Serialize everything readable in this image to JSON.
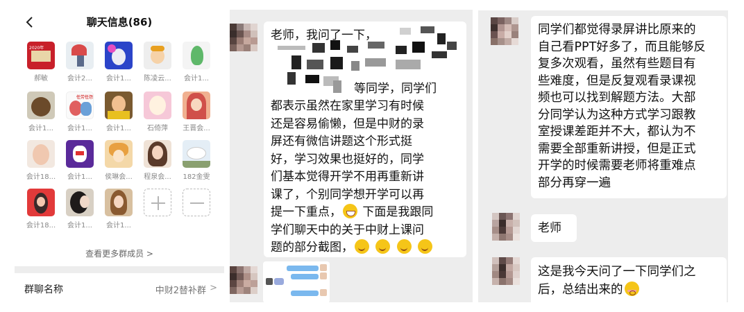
{
  "group_info": {
    "title": "聊天信息(86)",
    "members": [
      {
        "name": "郝敏",
        "avatar_text": "2020年"
      },
      {
        "name": "会计2...",
        "avatar_text": ""
      },
      {
        "name": "会计1...",
        "avatar_text": ""
      },
      {
        "name": "陈凌云...",
        "avatar_text": ""
      },
      {
        "name": "会计1...",
        "avatar_text": ""
      },
      {
        "name": "会计1...",
        "avatar_text": ""
      },
      {
        "name": "会计1...",
        "avatar_text": "任劳任怨"
      },
      {
        "name": "会计1...",
        "avatar_text": ""
      },
      {
        "name": "石倚萍",
        "avatar_text": ""
      },
      {
        "name": "王晋会...",
        "avatar_text": ""
      },
      {
        "name": "会计18...",
        "avatar_text": ""
      },
      {
        "name": "会计1...",
        "avatar_text": ""
      },
      {
        "name": "侯琳会...",
        "avatar_text": ""
      },
      {
        "name": "程泉会...",
        "avatar_text": ""
      },
      {
        "name": "182金雯",
        "avatar_text": ""
      },
      {
        "name": "会计18...",
        "avatar_text": ""
      },
      {
        "name": "会计1...",
        "avatar_text": ""
      },
      {
        "name": "会计1...",
        "avatar_text": ""
      }
    ],
    "more_members": "查看更多群成员 >",
    "group_name_label": "群聊名称",
    "group_name_value": "中财2替补群",
    "chevron": ">"
  },
  "chat_left": {
    "bubble_lines": [
      "老师，我问了一下，",
      "",
      "",
      "等同学，同学们",
      "都表示虽然在家里学习有时候",
      "还是容易偷懒，但是中财的录",
      "屏还有微信讲题这个形式挺",
      "好，学习效果也挺好的，同学",
      "们基本觉得开学不用再重新讲",
      "课了，个别同学想开学可以再",
      "提一下重点，",
      "学们聊天中的关于中财上课问",
      "题的部分截图，"
    ],
    "line_11_tail": "下面是我跟同"
  },
  "chat_right": {
    "summary_lines": [
      "同学们都觉得录屏讲比原来的",
      "自己看PPT好多了，而且能够反",
      "复多次观看，虽然有些题目有",
      "些难度，但是反复观看录课视",
      "频也可以找到解题方法。大部",
      "分同学认为这种方式学习跟教",
      "室授课差距并不大，都认为不",
      "需要全部重新讲授，但是正式",
      "开学的时候需要老师将重难点",
      "部分再穿一遍"
    ],
    "teacher_msg": "老师",
    "last_msg_lines": [
      "这是我今天问了一下同学们之",
      "后，总结出来的"
    ]
  },
  "colors": {
    "bubble": "#ffffff",
    "chat_bg": "#ededed",
    "emoji": "#f5c518"
  }
}
